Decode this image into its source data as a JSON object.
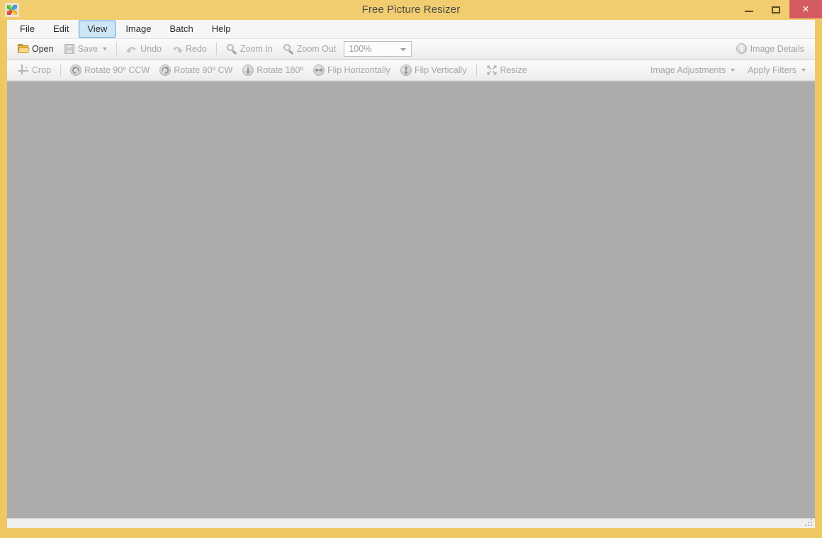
{
  "window": {
    "title": "Free Picture Resizer",
    "app_icon": "pinwheel-app-icon",
    "frame_color": "#f0c862",
    "titlebar_color": "#f2cd70",
    "close_button_color": "#d45b5f",
    "controls": {
      "minimize": "minimize",
      "maximize": "maximize",
      "close": "×"
    }
  },
  "menubar": {
    "items": [
      {
        "label": "File",
        "active": false
      },
      {
        "label": "Edit",
        "active": false
      },
      {
        "label": "View",
        "active": true
      },
      {
        "label": "Image",
        "active": false
      },
      {
        "label": "Batch",
        "active": false
      },
      {
        "label": "Help",
        "active": false
      }
    ],
    "active_highlight_bg": "#cde6f7",
    "active_highlight_border": "#4a9ad4"
  },
  "toolbar_row1": {
    "open_label": "Open",
    "save_label": "Save",
    "undo_label": "Undo",
    "redo_label": "Redo",
    "zoom_in_label": "Zoom In",
    "zoom_out_label": "Zoom Out",
    "zoom_value": "100%",
    "image_details_label": "Image Details"
  },
  "toolbar_row2": {
    "crop_label": "Crop",
    "rotate_ccw_label": "Rotate 90º CCW",
    "rotate_cw_label": "Rotate 90º CW",
    "rotate_180_label": "Rotate 180º",
    "flip_h_label": "Flip Horizontally",
    "flip_v_label": "Flip Vertically",
    "resize_label": "Resize",
    "image_adjustments_label": "Image Adjustments",
    "apply_filters_label": "Apply Filters"
  },
  "canvas": {
    "background_color": "#acacac",
    "content": ""
  },
  "statusbar": {
    "text": "",
    "grip": "resize-grip"
  }
}
